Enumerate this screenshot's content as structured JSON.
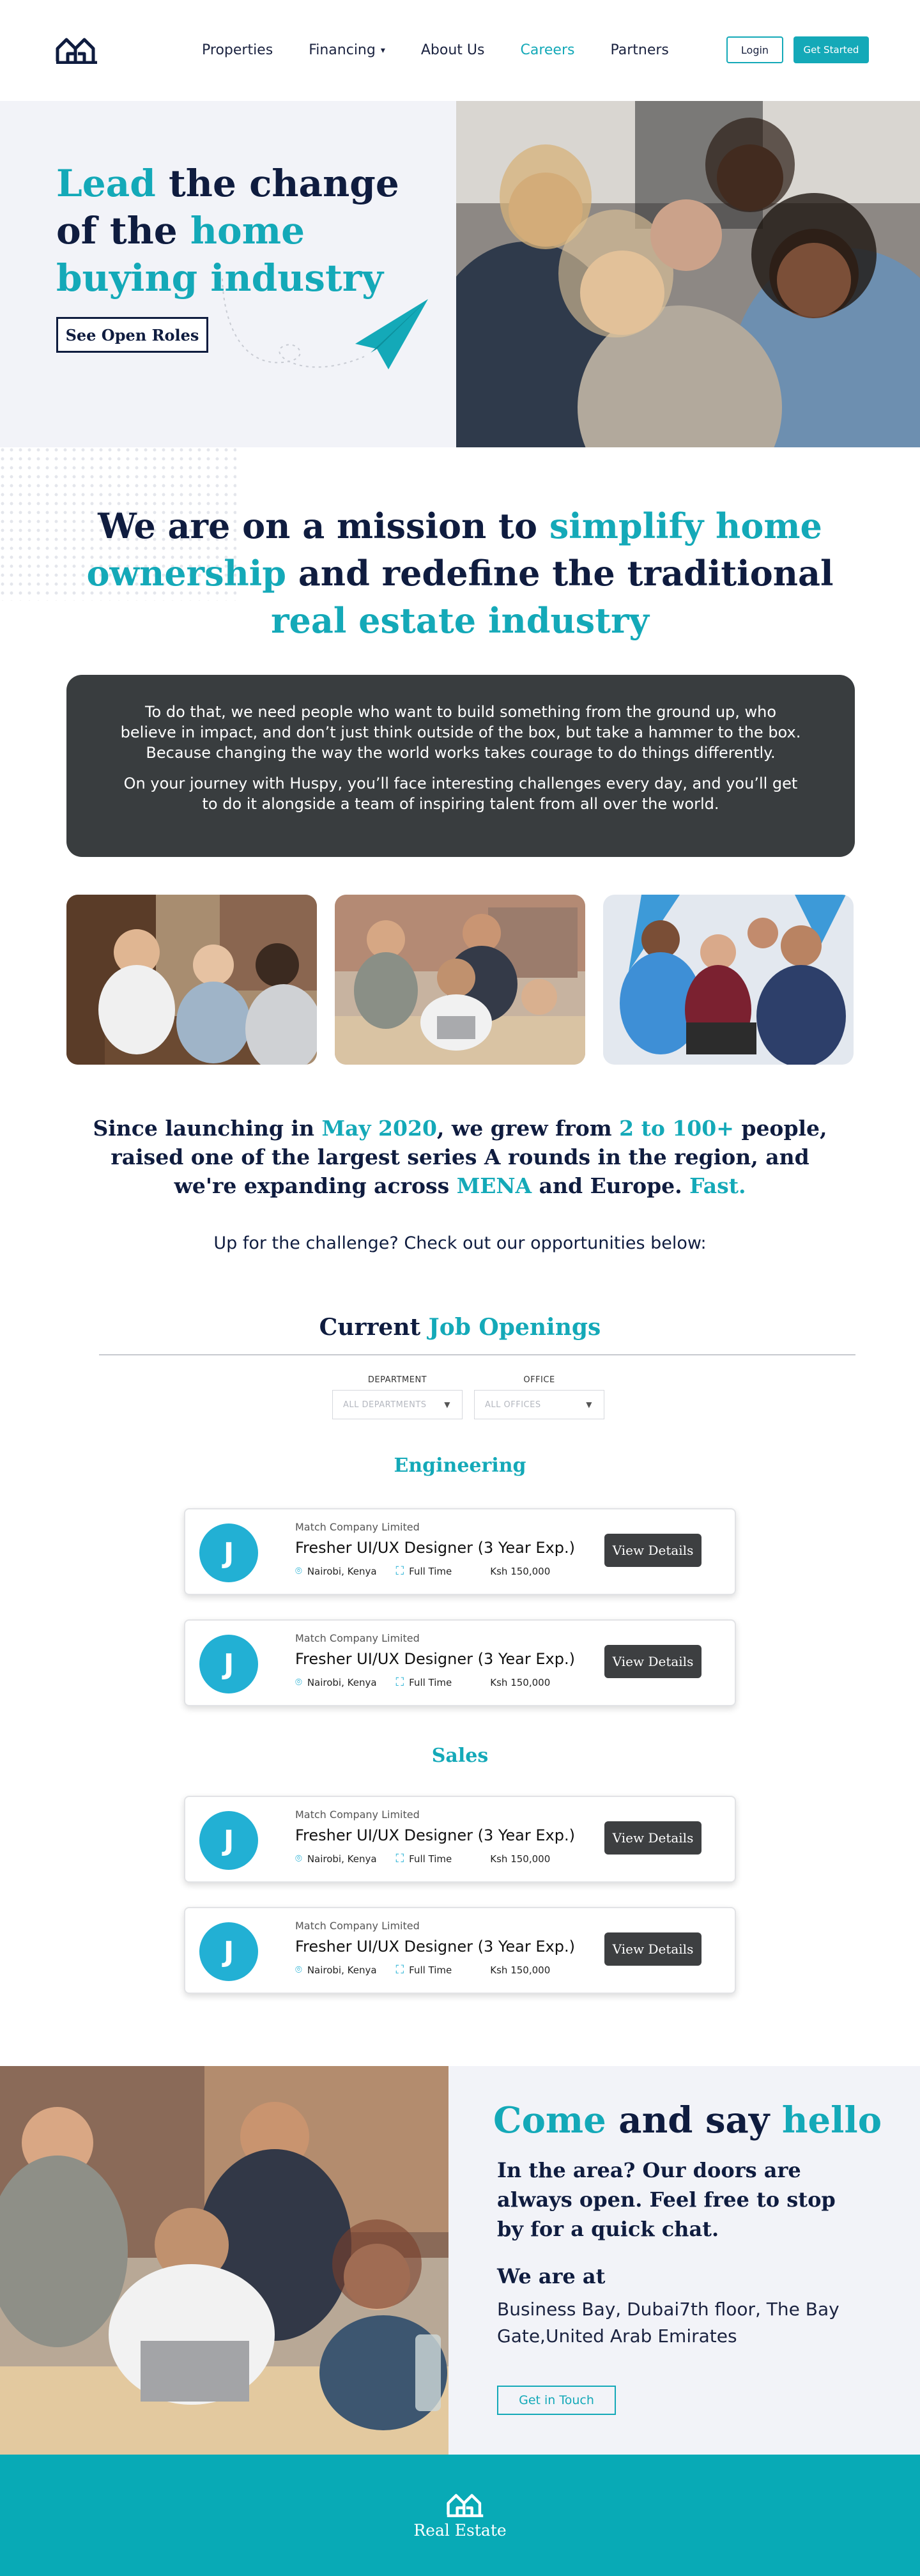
{
  "nav": {
    "links": [
      {
        "label": "Properties"
      },
      {
        "label": "Financing"
      },
      {
        "label": "About Us"
      },
      {
        "label": "Careers"
      },
      {
        "label": "Partners"
      }
    ],
    "login_label": "Login",
    "get_started_label": "Get Started"
  },
  "hero": {
    "title_parts": [
      "Lead",
      " the change of the ",
      "home buying industry"
    ],
    "button_label": "See Open Roles"
  },
  "mission": {
    "title_parts": [
      "We are on a mission to ",
      "simplify home ownership",
      " and redefine the traditional ",
      "real estate industry"
    ],
    "paragraph_1": "To do that, we need people who want to build something from the ground up, who believe in impact, and don’t just think outside of the box, but take a hammer to the box. Because changing the way the world works takes courage to do things differently.",
    "paragraph_2": "On your journey with Huspy, you’ll face interesting challenges every day, and you’ll get to do it alongside a team of inspiring talent from all over the world."
  },
  "stats": {
    "parts": [
      "Since launching in ",
      "May 2020",
      ", we grew from ",
      "2 to 100+",
      " people, raised one of the largest series A rounds in the region, and we're expanding across ",
      "MENA",
      " and Europe. ",
      "Fast."
    ]
  },
  "challenge_text": "Up for the challenge? Check out our opportunities below:",
  "openings": {
    "title_parts": [
      "Current ",
      "Job Openings"
    ],
    "department_label": "DEPARTMENT",
    "department_value": "ALL DEPARTMENTS",
    "office_label": "OFFICE",
    "office_value": "ALL OFFICES"
  },
  "sections": [
    {
      "title": "Engineering"
    },
    {
      "title": "Sales"
    }
  ],
  "jobs": [
    {
      "avatar": "J",
      "company": "Match Company Limited",
      "title": "Fresher UI/UX Designer (3 Year Exp.)",
      "location": "Nairobi, Kenya",
      "type": "Full Time",
      "salary": "Ksh 150,000",
      "button": "View Details"
    },
    {
      "avatar": "J",
      "company": "Match Company Limited",
      "title": "Fresher UI/UX Designer (3 Year Exp.)",
      "location": "Nairobi, Kenya",
      "type": "Full Time",
      "salary": "Ksh 150,000",
      "button": "View Details"
    },
    {
      "avatar": "J",
      "company": "Match Company Limited",
      "title": "Fresher UI/UX Designer (3 Year Exp.)",
      "location": "Nairobi, Kenya",
      "type": "Full Time",
      "salary": "Ksh 150,000",
      "button": "View Details"
    },
    {
      "avatar": "J",
      "company": "Match Company Limited",
      "title": "Fresher UI/UX Designer (3 Year Exp.)",
      "location": "Nairobi, Kenya",
      "type": "Full Time",
      "salary": "Ksh 150,000",
      "button": "View Details"
    }
  ],
  "contact": {
    "title_parts": [
      "Come",
      " and say ",
      "hello"
    ],
    "lead": "In the area? Our doors are always open. Feel free to stop by for a quick chat.",
    "heading": "We are at",
    "address": "Business Bay, Dubai7th floor, The Bay Gate,United Arab Emirates",
    "button_label": "Get in Touch"
  },
  "footer": {
    "brand": "Real Estate"
  },
  "colors": {
    "accent": "#14a9b8",
    "navy": "#0f1c3f",
    "dark_box": "#393d3f",
    "footer": "#08aab6"
  }
}
